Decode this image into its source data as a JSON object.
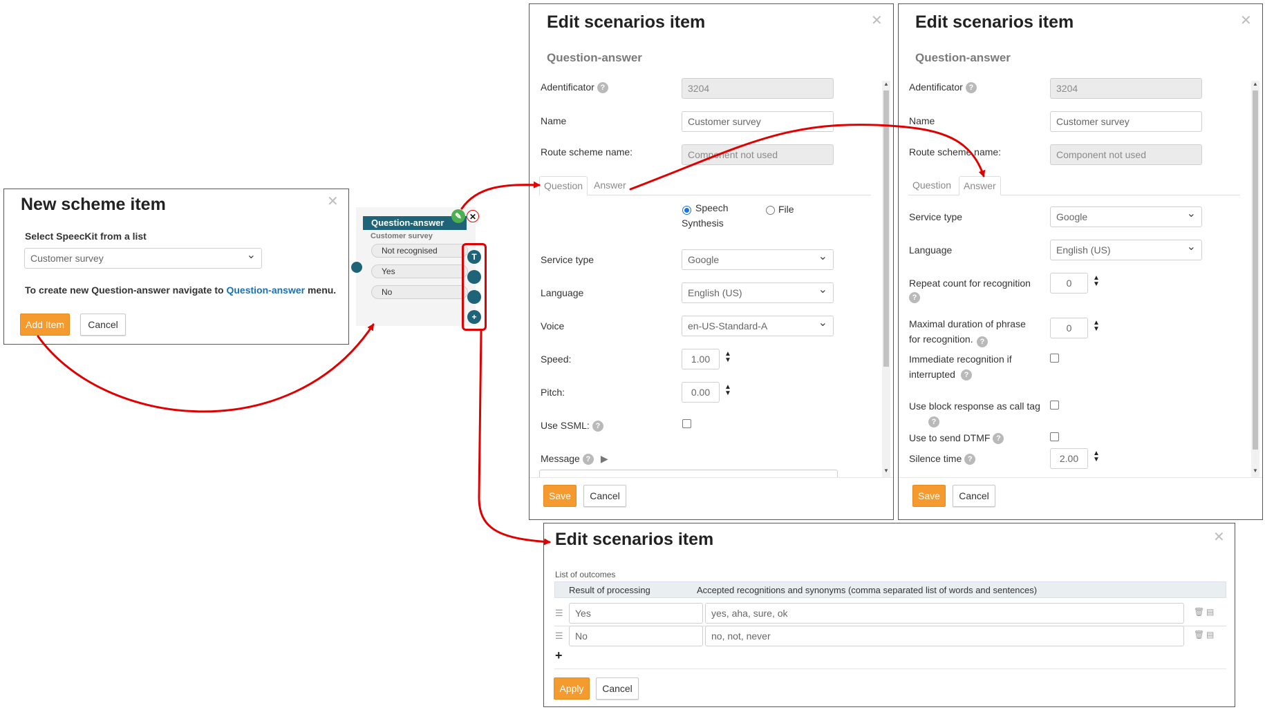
{
  "new_item": {
    "title": "New scheme item",
    "select_label": "Select SpeecKit from a list",
    "select_value": "Customer survey",
    "hint_prefix": "To create new Question-answer navigate to ",
    "hint_link": "Question-answer",
    "hint_suffix": " menu.",
    "add_label": "Add Item",
    "cancel_label": "Cancel"
  },
  "node": {
    "title": "Question-answer",
    "subtitle": "Customer survey",
    "outcomes": [
      "Not recognised",
      "Yes",
      "No"
    ],
    "port_top": "T",
    "port_add": "+"
  },
  "edit_question": {
    "title": "Edit scenarios item",
    "subtitle": "Question-answer",
    "id_label": "Adentificator",
    "id_value": "3204",
    "name_label": "Name",
    "name_value": "Customer survey",
    "route_label": "Route scheme name:",
    "route_value": "Component not used",
    "tabs": [
      "Question",
      "Answer"
    ],
    "radio_speech": "Speech Synthesis",
    "radio_file": "File",
    "service_label": "Service type",
    "service_value": "Google",
    "language_label": "Language",
    "language_value": "English (US)",
    "voice_label": "Voice",
    "voice_value": "en-US-Standard-A",
    "speed_label": "Speed:",
    "speed_value": "1.00",
    "pitch_label": "Pitch:",
    "pitch_value": "0.00",
    "ssml_label": "Use SSML:",
    "message_label": "Message",
    "save_label": "Save",
    "cancel_label": "Cancel"
  },
  "edit_answer": {
    "title": "Edit scenarios item",
    "subtitle": "Question-answer",
    "id_label": "Adentificator",
    "id_value": "3204",
    "name_label": "Name",
    "name_value": "Customer survey",
    "route_label": "Route scheme name:",
    "route_value": "Component not used",
    "tabs": [
      "Question",
      "Answer"
    ],
    "service_label": "Service type",
    "service_value": "Google",
    "language_label": "Language",
    "language_value": "English (US)",
    "repeat_label": "Repeat count for recognition",
    "repeat_value": "0",
    "maxdur_label": "Maximal duration of phrase for recognition.",
    "maxdur_value": "0",
    "immediate_label": "Immediate recognition if interrupted",
    "block_label": "Use block response as call tag",
    "dtmf_label": "Use to send DTMF",
    "silence_label": "Silence time",
    "silence_value": "2.00",
    "save_label": "Save",
    "cancel_label": "Cancel"
  },
  "edit_outcomes": {
    "title": "Edit scenarios item",
    "list_label": "List of outcomes",
    "col_result": "Result of processing",
    "col_accepted": "Accepted recognitions and synonyms (comma separated list of words and sentences)",
    "rows": [
      {
        "result": "Yes",
        "accepted": "yes, aha, sure, ok"
      },
      {
        "result": "No",
        "accepted": "no, not, never"
      }
    ],
    "apply_label": "Apply",
    "cancel_label": "Cancel"
  },
  "colors": {
    "accent_orange": "#f59a2e",
    "node_teal": "#1e6378",
    "arrow_red": "#e00000",
    "link_blue": "#1a6fb5"
  }
}
